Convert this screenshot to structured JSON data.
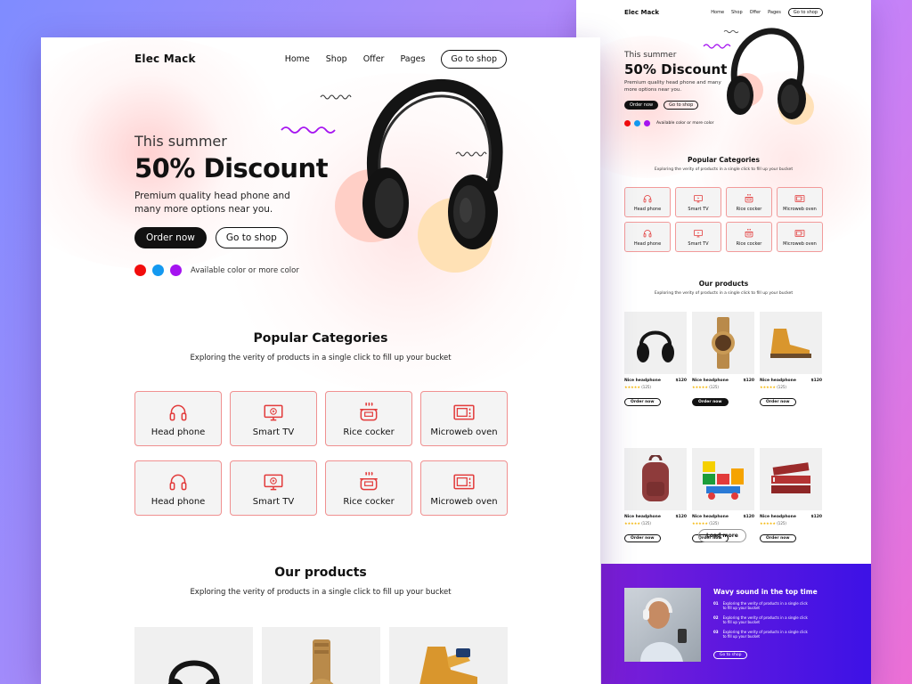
{
  "brand": "Elec Mack",
  "nav": {
    "links": [
      "Home",
      "Shop",
      "Offer",
      "Pages"
    ],
    "cta": "Go to shop"
  },
  "hero": {
    "kicker": "This summer",
    "headline": "50% Discount",
    "description": "Premium quality head phone and many more options near you.",
    "primary_button": "Order now",
    "secondary_button": "Go to shop",
    "colors_label": "Available color or more color",
    "colors": [
      "#f20d0d",
      "#1499f0",
      "#a513f0"
    ]
  },
  "categories": {
    "title": "Popular Categories",
    "subtitle": "Exploring the verity of products in a single click to fill up your bucket",
    "items": [
      {
        "label": "Head phone",
        "icon": "headphone-icon"
      },
      {
        "label": "Smart TV",
        "icon": "smart-tv-icon"
      },
      {
        "label": "Rice cocker",
        "icon": "rice-cooker-icon"
      },
      {
        "label": "Microweb oven",
        "icon": "microwave-icon"
      },
      {
        "label": "Head phone",
        "icon": "headphone-icon"
      },
      {
        "label": "Smart TV",
        "icon": "smart-tv-icon"
      },
      {
        "label": "Rice cocker",
        "icon": "rice-cooker-icon"
      },
      {
        "label": "Microweb oven",
        "icon": "microwave-icon"
      }
    ]
  },
  "products": {
    "title": "Our products",
    "subtitle": "Exploring the verity of products in a single click to fill up your bucket",
    "items": [
      {
        "name": "Nice headphone",
        "price": "$120",
        "rating": "★★★★★",
        "reviews": "(125)",
        "button": "Order now",
        "image": "headphone"
      },
      {
        "name": "Nice headphone",
        "price": "$120",
        "rating": "★★★★★",
        "reviews": "(125)",
        "button": "Order now",
        "image": "watch"
      },
      {
        "name": "Nice headphone",
        "price": "$120",
        "rating": "★★★★★",
        "reviews": "(125)",
        "button": "Order now",
        "image": "boot"
      },
      {
        "name": "Nice headphone",
        "price": "$120",
        "rating": "★★★★★",
        "reviews": "(125)",
        "button": "Order now",
        "image": "backpack"
      },
      {
        "name": "Nice headphone",
        "price": "$120",
        "rating": "★★★★★",
        "reviews": "(125)",
        "button": "Order now",
        "image": "blocks"
      },
      {
        "name": "Nice headphone",
        "price": "$120",
        "rating": "★★★★★",
        "reviews": "(125)",
        "button": "Order now",
        "image": "books"
      }
    ],
    "load_more": "Load more"
  },
  "feature": {
    "title": "Wavy sound in the top time",
    "items": [
      {
        "num": "01",
        "text": "Exploring the verity of products in a single click to fill up your bucket"
      },
      {
        "num": "02",
        "text": "Exploring the verity of products in a single click to fill up your bucket"
      },
      {
        "num": "03",
        "text": "Exploring the verity of products in a single click to fill up your bucket"
      }
    ],
    "button": "Go to shop"
  },
  "theme": {
    "accent": "#111111",
    "category_border": "#f09090",
    "category_icon": "#e23b3b",
    "footer_gradient_start": "#7d1fd6",
    "footer_gradient_end": "#3d12e6"
  }
}
